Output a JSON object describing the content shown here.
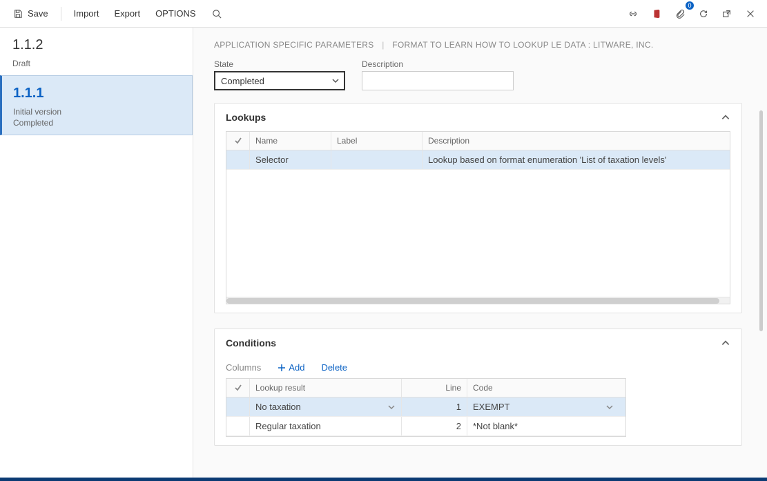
{
  "toolbar": {
    "save": "Save",
    "import": "Import",
    "export": "Export",
    "options": "OPTIONS"
  },
  "notifications": {
    "count": "0"
  },
  "sidebar": {
    "items": [
      {
        "title": "1.1.2",
        "subtitle": "Draft"
      },
      {
        "title": "1.1.1",
        "line1": "Initial version",
        "line2": "Completed"
      }
    ]
  },
  "breadcrumb": {
    "part1": "APPLICATION SPECIFIC PARAMETERS",
    "part2": "FORMAT TO LEARN HOW TO LOOKUP LE DATA : LITWARE, INC."
  },
  "form": {
    "state_label": "State",
    "state_value": "Completed",
    "description_label": "Description",
    "description_value": ""
  },
  "lookups": {
    "title": "Lookups",
    "columns": {
      "name": "Name",
      "label": "Label",
      "description": "Description"
    },
    "rows": [
      {
        "name": "Selector",
        "label": "",
        "description": "Lookup based on format enumeration 'List of taxation levels'"
      }
    ]
  },
  "conditions": {
    "title": "Conditions",
    "toolbar": {
      "columns": "Columns",
      "add": "Add",
      "delete": "Delete"
    },
    "columns": {
      "lookup_result": "Lookup result",
      "line": "Line",
      "code": "Code"
    },
    "rows": [
      {
        "lookup_result": "No taxation",
        "line": "1",
        "code": "EXEMPT"
      },
      {
        "lookup_result": "Regular taxation",
        "line": "2",
        "code": "*Not blank*"
      }
    ]
  }
}
